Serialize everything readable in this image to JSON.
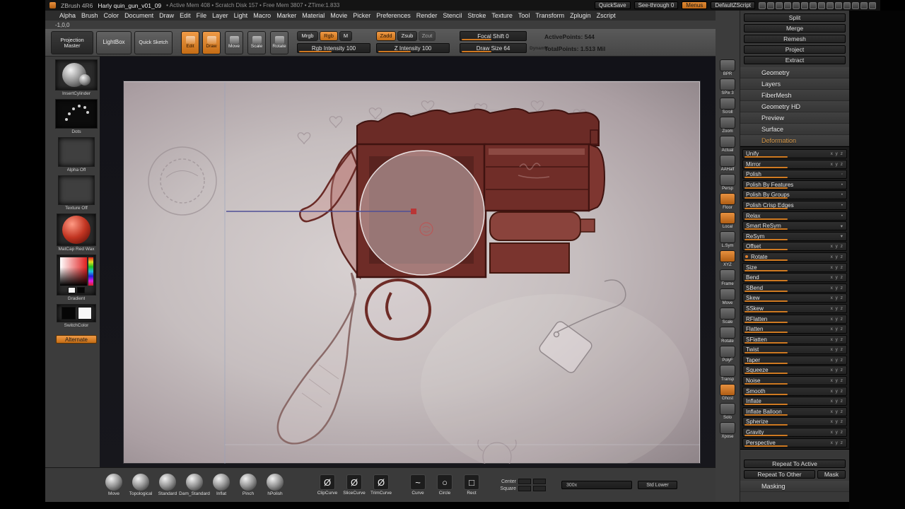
{
  "colors": {
    "accent": "#d07820",
    "model_red": "#6e2c27",
    "panel_dark": "#1c1c1c"
  },
  "titlebar": {
    "app": "ZBrush 4R6",
    "document": "Harly quin_gun_v01_09",
    "stats": "• Active Mem 408 • Scratch Disk 157 • Free Mem 3807 • ZTime:1.833",
    "quicksave": "QuickSave",
    "see_through": "See-through 0",
    "menus": "Menus",
    "default_zscript": "DefaultZScript",
    "dock_icons": [
      "brush-palette-icon",
      "stroke-palette-icon",
      "alpha-palette-icon",
      "texture-palette-icon",
      "material-palette-icon",
      "color-palette-icon",
      "document-palette-icon",
      "layer-palette-icon",
      "light-palette-icon",
      "render-palette-icon",
      "tool-palette-icon",
      "transform-palette-icon",
      "zplugin-palette-icon",
      "zscript-palette-icon"
    ]
  },
  "menubar": [
    "Alpha",
    "Brush",
    "Color",
    "Document",
    "Draw",
    "Edit",
    "File",
    "Layer",
    "Light",
    "Macro",
    "Marker",
    "Material",
    "Movie",
    "Picker",
    "Preferences",
    "Render",
    "Stencil",
    "Stroke",
    "Texture",
    "Tool",
    "Transform",
    "Zplugin",
    "Zscript"
  ],
  "coords": "-1,0,0",
  "toolbar": {
    "projection_master": "Projection Master",
    "lightbox": "LightBox",
    "quick_sketch": "Quick Sketch",
    "edit": "Edit",
    "draw": "Draw",
    "move": "Move",
    "scale": "Scale",
    "rotate": "Rotate",
    "mrgb": "Mrgb",
    "rgb": "Rgb",
    "m": "M",
    "zadd": "Zadd",
    "zsub": "Zsub",
    "zcut": "Zcut",
    "rgb_intensity": "Rgb Intensity 100",
    "z_intensity": "Z Intensity 100",
    "focal_shift": "Focal Shift 0",
    "draw_size": "Draw Size 64",
    "dynamic": "Dynamic",
    "active_points": "ActivePoints: 544",
    "total_points": "TotalPoints: 1.513 Mil"
  },
  "left_palette": {
    "tool_label": "InsertCylinder",
    "stroke_label": "Dots",
    "alpha_label": "Alpha Off",
    "texture_label": "Texture Off",
    "material_label": "MatCap Red Wax",
    "gradient_label": "Gradient",
    "switch_label": "SwitchColor",
    "alternate": "Alternate"
  },
  "right_strip": [
    {
      "label": "BPR",
      "icon": "bpr-render-icon",
      "accent": false
    },
    {
      "label": "SPix 3",
      "icon": "spix-icon",
      "accent": false
    },
    {
      "label": "Scroll",
      "icon": "scroll-icon",
      "accent": false
    },
    {
      "label": "Zoom",
      "icon": "zoom-icon",
      "accent": false
    },
    {
      "label": "Actual",
      "icon": "actual-size-icon",
      "accent": false
    },
    {
      "label": "AAHalf",
      "icon": "aahalf-icon",
      "accent": false
    },
    {
      "label": "Persp",
      "icon": "perspective-icon",
      "accent": false
    },
    {
      "label": "Floor",
      "icon": "floor-grid-icon",
      "accent": true
    },
    {
      "label": "Local",
      "icon": "local-transform-icon",
      "accent": true
    },
    {
      "label": "L.Sym",
      "icon": "local-symmetry-icon",
      "accent": false
    },
    {
      "label": "XYZ",
      "icon": "xyz-axis-icon",
      "accent": true
    },
    {
      "label": "Frame",
      "icon": "frame-icon",
      "accent": false
    },
    {
      "label": "Move",
      "icon": "move-gizmo-icon",
      "accent": false
    },
    {
      "label": "Scale",
      "icon": "scale-gizmo-icon",
      "accent": false
    },
    {
      "label": "Rotate",
      "icon": "rotate-gizmo-icon",
      "accent": false
    },
    {
      "label": "PolyF",
      "icon": "polyframe-icon",
      "accent": false
    },
    {
      "label": "Transp",
      "icon": "transparency-icon",
      "accent": false
    },
    {
      "label": "Ghost",
      "icon": "ghost-transparency-icon",
      "accent": true
    },
    {
      "label": "Solo",
      "icon": "solo-icon",
      "accent": false
    },
    {
      "label": "Xpose",
      "icon": "xpose-icon",
      "accent": false
    }
  ],
  "right_panel": {
    "top_buttons": [
      "Split",
      "Merge",
      "Remesh",
      "Project",
      "Extract"
    ],
    "sections": [
      "Geometry",
      "Layers",
      "FiberMesh",
      "Geometry HD",
      "Preview",
      "Surface"
    ],
    "deformation_title": "Deformation",
    "deformation_rows": [
      {
        "label": "Unify",
        "axes": "x y z",
        "accent": false
      },
      {
        "label": "Mirror",
        "axes": "x y z",
        "accent": false
      },
      {
        "label": "Polish",
        "axes": "◦",
        "accent": false
      },
      {
        "label": "Polish By Features",
        "axes": "•",
        "accent": false
      },
      {
        "label": "Polish By Groups",
        "axes": "•",
        "accent": false
      },
      {
        "label": "Polish Crisp Edges",
        "axes": "•",
        "accent": false
      },
      {
        "label": "Relax",
        "axes": "•",
        "accent": false
      },
      {
        "label": "Smart ReSym",
        "axes": "▾",
        "accent": false
      },
      {
        "label": "ReSym",
        "axes": "▾",
        "accent": false
      },
      {
        "label": "Offset",
        "axes": "x y z",
        "accent": false
      },
      {
        "label": "Rotate",
        "axes": "x y z",
        "accent": true
      },
      {
        "label": "Size",
        "axes": "x y z",
        "accent": false
      },
      {
        "label": "Bend",
        "axes": "x y z",
        "accent": false
      },
      {
        "label": "SBend",
        "axes": "x y z",
        "accent": false
      },
      {
        "label": "Skew",
        "axes": "x y z",
        "accent": false
      },
      {
        "label": "SSkew",
        "axes": "x y z",
        "accent": false
      },
      {
        "label": "RFlatten",
        "axes": "x y z",
        "accent": false
      },
      {
        "label": "Flatten",
        "axes": "x y z",
        "accent": false
      },
      {
        "label": "SFlatten",
        "axes": "x y z",
        "accent": false
      },
      {
        "label": "Twist",
        "axes": "x y z",
        "accent": false
      },
      {
        "label": "Taper",
        "axes": "x y z",
        "accent": false
      },
      {
        "label": "Squeeze",
        "axes": "x y z",
        "accent": false
      },
      {
        "label": "Noise",
        "axes": "x y z",
        "accent": false
      },
      {
        "label": "Smooth",
        "axes": "x y z",
        "accent": false
      },
      {
        "label": "Inflate",
        "axes": "x y z",
        "accent": false
      },
      {
        "label": "Inflate Balloon",
        "axes": "x y z",
        "accent": false
      },
      {
        "label": "Spherize",
        "axes": "x y z",
        "accent": false
      },
      {
        "label": "Gravity",
        "axes": "x y z",
        "accent": false
      },
      {
        "label": "Perspective",
        "axes": "x y z",
        "accent": false
      }
    ],
    "repeat_active": "Repeat To Active",
    "repeat_other": "Repeat To Other",
    "mask": "Mask",
    "masking_title": "Masking"
  },
  "bottom_tray": {
    "brushes": [
      {
        "label": "Move",
        "icon": "move-brush-icon"
      },
      {
        "label": "Topological",
        "icon": "topological-brush-icon"
      },
      {
        "label": "Standard",
        "icon": "standard-brush-icon"
      },
      {
        "label": "Dam_Standard",
        "icon": "dam-standard-brush-icon"
      },
      {
        "label": "Inflat",
        "icon": "inflat-brush-icon"
      },
      {
        "label": "Pinch",
        "icon": "pinch-brush-icon"
      },
      {
        "label": "hPolish",
        "icon": "hpolish-brush-icon"
      }
    ],
    "clip_brushes": [
      {
        "label": "ClipCurve",
        "icon": "clipcurve-brush-icon",
        "glyph": "Ø"
      },
      {
        "label": "SliceCurve",
        "icon": "slicecurve-brush-icon",
        "glyph": "Ø"
      },
      {
        "label": "TrimCurve",
        "icon": "trimcurve-brush-icon",
        "glyph": "Ø"
      }
    ],
    "strokes": [
      {
        "label": "Curve",
        "icon": "curve-stroke-icon",
        "glyph": "~"
      },
      {
        "label": "Circle",
        "icon": "circle-stroke-icon",
        "glyph": "○"
      },
      {
        "label": "Rect",
        "icon": "rect-stroke-icon",
        "glyph": "□"
      }
    ],
    "center_label": "Center",
    "square_label": "Square",
    "zoom_value": "300x",
    "std_lower": "Std Lower"
  }
}
